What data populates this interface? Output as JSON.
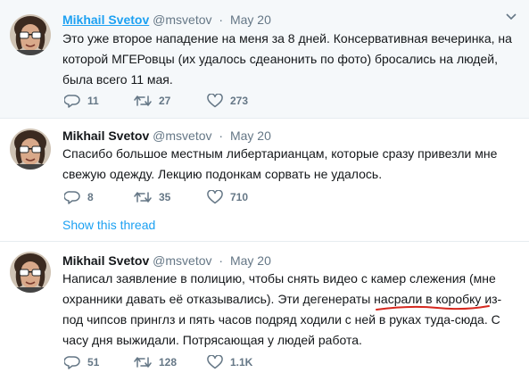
{
  "tweets": [
    {
      "name": "Mikhail Svetov",
      "handle": "@msvetov",
      "date": "May 20",
      "text": "Это уже второе нападение на меня за 8 дней. Консервативная вечеринка, на которой МГЕРовцы (их удалось сдеанонить по фото) бросались на людей, была всего 11 мая.",
      "replies": "11",
      "retweets": "27",
      "likes": "273"
    },
    {
      "name": "Mikhail Svetov",
      "handle": "@msvetov",
      "date": "May 20",
      "text": "Спасибо большое местным либертарианцам, которые сразу привезли мне свежую одежду. Лекцию подонкам сорвать не удалось.",
      "replies": "8",
      "retweets": "35",
      "likes": "710",
      "show_thread": "Show this thread"
    },
    {
      "name": "Mikhail Svetov",
      "handle": "@msvetov",
      "date": "May 20",
      "text": "Написал заявление в полицию, чтобы снять видео с камер слежения (мне охранники давать её отказывались). Эти дегенераты насрали в коробку из-под чипсов принглз и пять часов подряд ходили с ней в руках туда-сюда. С часу дня выжидали. Потрясающая у людей работа.",
      "replies": "51",
      "retweets": "128",
      "likes": "1.1K"
    }
  ],
  "separator": "·",
  "colors": {
    "link": "#1da1f2",
    "muted": "#657786",
    "hover_bg": "#f5f8fa",
    "annotation": "#d6281f"
  }
}
